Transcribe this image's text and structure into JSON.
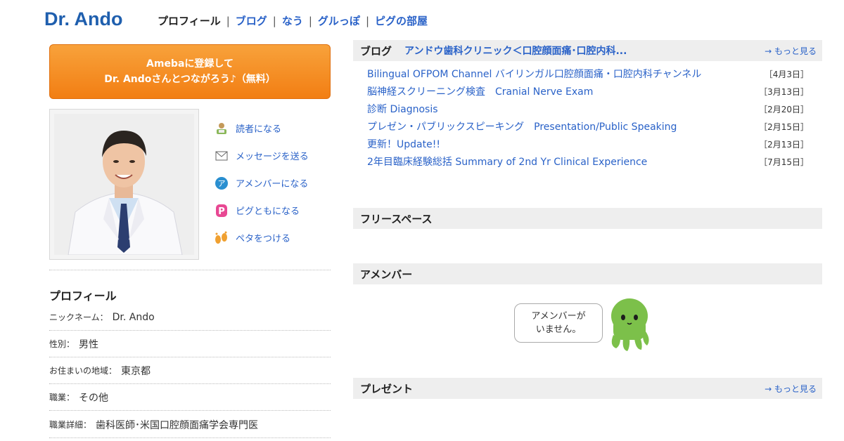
{
  "header": {
    "title": "Dr. Ando",
    "nav": [
      "プロフィール",
      "ブログ",
      "なう",
      "グルっぽ",
      "ピグの部屋"
    ]
  },
  "register": {
    "line1": "Amebaに登録して",
    "line2": "Dr. Andoさんとつながろう♪（無料）"
  },
  "actions": [
    {
      "label": "読者になる",
      "icon": "reader-icon"
    },
    {
      "label": "メッセージを送る",
      "icon": "mail-icon"
    },
    {
      "label": "アメンバーになる",
      "icon": "amember-icon"
    },
    {
      "label": "ピグともになる",
      "icon": "pigg-icon"
    },
    {
      "label": "ペタをつける",
      "icon": "footprint-icon"
    }
  ],
  "profile": {
    "heading": "プロフィール",
    "rows": [
      {
        "key": "ニックネーム：",
        "value": "Dr. Ando"
      },
      {
        "key": "性別：",
        "value": "男性"
      },
      {
        "key": "お住まいの地域：",
        "value": "東京都"
      },
      {
        "key": "職業：",
        "value": "その他"
      },
      {
        "key": "職業詳細：",
        "value": "歯科医師･米国口腔顔面痛学会専門医"
      }
    ]
  },
  "blog": {
    "label": "ブログ",
    "title": "アンドウ歯科クリニック＜口腔顔面痛･口腔内科...",
    "more": "→ もっと見る",
    "entries": [
      {
        "title": "Bilingual OFPOM Channel バイリンガル口腔顔面痛・口腔内科チャンネル",
        "date": "［4月3日］"
      },
      {
        "title": "脳神経スクリーニング検査　Cranial Nerve Exam",
        "date": "［3月13日］"
      },
      {
        "title": "診断 Diagnosis",
        "date": "［2月20日］"
      },
      {
        "title": "プレゼン・パブリックスピーキング　Presentation/Public Speaking",
        "date": "［2月15日］"
      },
      {
        "title": "更新！Update!!",
        "date": "［2月13日］"
      },
      {
        "title": "2年目臨床経験総括 Summary of 2nd Yr Clinical Experience",
        "date": "［7月15日］"
      }
    ]
  },
  "freespace": {
    "label": "フリースペース"
  },
  "amember": {
    "label": "アメンバー",
    "bubble_line1": "アメンバーが",
    "bubble_line2": "いません。"
  },
  "present": {
    "label": "プレゼント",
    "more": "→ もっと見る"
  },
  "colors": {
    "accent": "#2a62c8",
    "button": "#f27e13",
    "title": "#1f5fae"
  }
}
